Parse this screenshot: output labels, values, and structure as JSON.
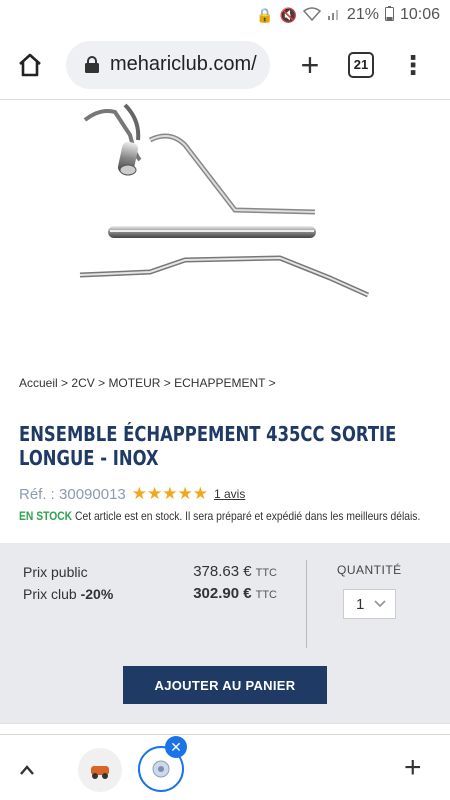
{
  "status": {
    "battery": "21%",
    "time": "10:06"
  },
  "browser": {
    "url": "mehariclub.com/",
    "tab_count": "21"
  },
  "breadcrumb": {
    "items": [
      "Accueil",
      "2CV",
      "MOTEUR",
      "ECHAPPEMENT"
    ],
    "sep": ">"
  },
  "product": {
    "title_line1": "ENSEMBLE ÉCHAPPEMENT 435CC SORTIE",
    "title_line2": "LONGUE - INOX",
    "ref": "Réf. : 30090013",
    "stars": "★★★★★",
    "rating": 5,
    "reviews": "1 avis",
    "stock_label": "EN STOCK",
    "stock_text": "Cet article est en stock. Il sera préparé et expédié dans les meilleurs délais."
  },
  "pricing": {
    "public_label": "Prix public",
    "public_value": "378.63 €",
    "public_unit": "TTC",
    "club_label": "Prix club",
    "club_discount": "-20%",
    "club_value": "302.90 €",
    "club_unit": "TTC",
    "qty_label": "QUANTITÉ",
    "qty_value": "1",
    "cart_button": "AJOUTER AU PANIER"
  },
  "colors": {
    "brand": "#1f3a64",
    "stock": "#2ea44f",
    "stars": "#f0a81e",
    "price_bg": "#e8eaee"
  }
}
